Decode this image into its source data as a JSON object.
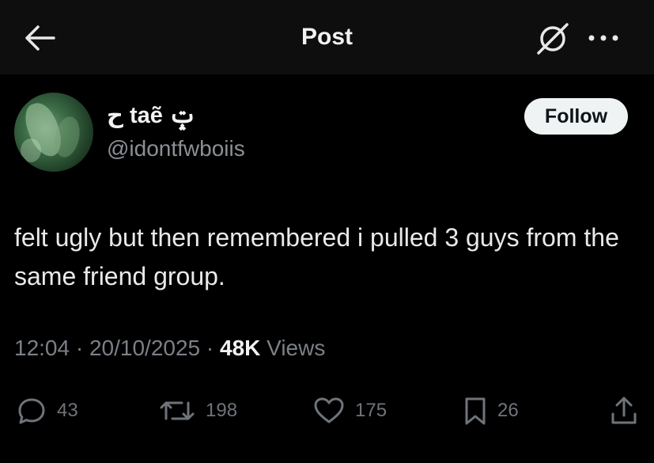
{
  "header": {
    "title": "Post",
    "icons": [
      "back-arrow-icon",
      "grok-icon",
      "more-icon"
    ]
  },
  "author": {
    "display_name": "ح taẽ ݓ",
    "handle": "@idontfwboiis",
    "follow_label": "Follow"
  },
  "post": {
    "text": "felt ugly but then remembered i pulled 3 guys from the same friend group.",
    "time": "12:04",
    "sep1": " · ",
    "date": "20/10/2025",
    "sep2": " · ",
    "views_count": "48K",
    "views_label": " Views"
  },
  "actions": {
    "replies": "43",
    "reposts": "198",
    "likes": "175",
    "bookmarks": "26"
  },
  "colors": {
    "background": "#000000",
    "header_bg": "#0e0e0e",
    "text": "#e9e9e9",
    "secondary": "#7b8086",
    "follow_bg": "#eff3f4"
  }
}
